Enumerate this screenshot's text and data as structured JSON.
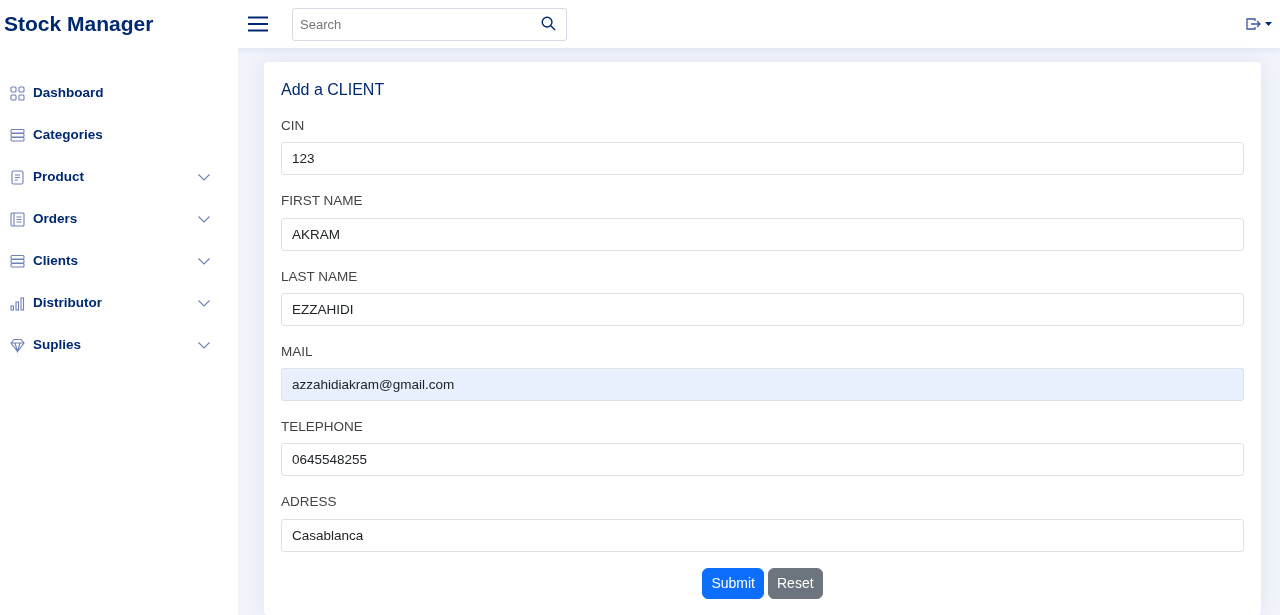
{
  "header": {
    "brand": "Stock Manager",
    "search": {
      "placeholder": "Search"
    }
  },
  "sidebar": {
    "items": [
      {
        "label": "Dashboard",
        "expandable": false
      },
      {
        "label": "Categories",
        "expandable": false
      },
      {
        "label": "Product",
        "expandable": true
      },
      {
        "label": "Orders",
        "expandable": true
      },
      {
        "label": "Clients",
        "expandable": true
      },
      {
        "label": "Distributor",
        "expandable": true
      },
      {
        "label": "Suplies",
        "expandable": true
      }
    ]
  },
  "form": {
    "title": "Add a CLIENT",
    "fields": [
      {
        "label": "CIN",
        "value": "123",
        "autofilled": false
      },
      {
        "label": "FIRST NAME",
        "value": "AKRAM",
        "autofilled": false
      },
      {
        "label": "LAST NAME",
        "value": "EZZAHIDI",
        "autofilled": false
      },
      {
        "label": "MAIL",
        "value": "azzahidiakram@gmail.com",
        "autofilled": true
      },
      {
        "label": "TELEPHONE",
        "value": "0645548255",
        "autofilled": false
      },
      {
        "label": "ADRESS",
        "value": "Casablanca",
        "autofilled": false
      }
    ],
    "buttons": [
      {
        "label": "Submit",
        "kind": "primary"
      },
      {
        "label": "Reset",
        "kind": "secondary"
      }
    ]
  }
}
